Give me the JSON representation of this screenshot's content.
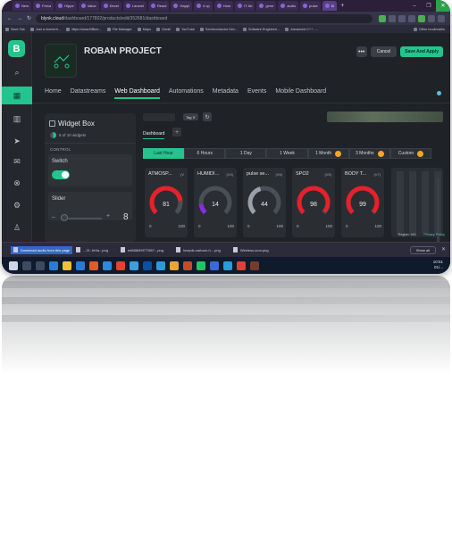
{
  "browser": {
    "tabs": [
      "New",
      "Freca",
      "Hippe",
      "Value",
      "Devel",
      "Laravel",
      "React",
      "Happi",
      "4 up",
      "Hum",
      "IT Ab",
      "gene",
      "audio",
      "pulse",
      "Bl"
    ],
    "url_host": "blynk.cloud",
    "url_path": "/dashboard/177802/products/edit/352681/dashboard",
    "bookmarks": [
      "Save Tab",
      "Just a moment...",
      "https://www.BBlee...",
      "File Manager",
      "Maps",
      "Gmail",
      "YouTube",
      "Semiconductor Dev...",
      "Software Engineeri...",
      "Advanced C++ -..."
    ],
    "bookmarks_right": "Other bookmarks"
  },
  "app": {
    "logo_letter": "B",
    "project_title": "ROBAN PROJECT",
    "buttons": {
      "more": "•••",
      "cancel": "Cancel",
      "save": "Save And Apply"
    },
    "tabs": [
      "Home",
      "Datastreams",
      "Web Dashboard",
      "Automations",
      "Metadata",
      "Events",
      "Mobile Dashboard"
    ],
    "active_tab": "Web Dashboard"
  },
  "widget_box": {
    "title": "Widget Box",
    "count": "5 of 10 widgets",
    "section": "CONTROL",
    "switch_label": "Switch",
    "slider_label": "Slider",
    "slider_minus": "–",
    "slider_plus": "+",
    "slider_value": "8"
  },
  "canvas": {
    "tag_chip": "Tag ✕",
    "refresh": "↻",
    "dashboard_tab": "Dashboard",
    "add_tab": "+",
    "ranges": [
      "Last Hour",
      "6 Hours",
      "1 Day",
      "1 Week",
      "1 Month",
      "3 Months",
      "Custom"
    ],
    "range_badges": [
      false,
      false,
      false,
      false,
      true,
      true,
      true
    ],
    "region": "Region: blr1",
    "privacy": "Privacy Policy"
  },
  "gauges": [
    {
      "title": "ATMOSP...",
      "pin": "(V",
      "value": 81,
      "min": 0,
      "max": 100,
      "color": "#e8202a"
    },
    {
      "title": "HUMIDI...",
      "pin": "(V4)",
      "value": 14,
      "min": 0,
      "max": 100,
      "color": "#8a2be2"
    },
    {
      "title": "pulse se...",
      "pin": "(V6)",
      "value": 44,
      "min": 0,
      "max": 100,
      "color": "#9aa0a7"
    },
    {
      "title": "SPO2",
      "pin": "(V6)",
      "value": 98,
      "min": 0,
      "max": 100,
      "color": "#e8202a"
    },
    {
      "title": "BODY T...",
      "pin": "(V7)",
      "value": 99,
      "min": 0,
      "max": 100,
      "color": "#e8202a"
    }
  ],
  "downloads": {
    "toast": "Download audio from this page",
    "items": [
      "...2f...fe9a...png",
      "ed6880f3f772f67...png",
      "lovepik-cartoon-h....png",
      "Wireless-icon.png"
    ],
    "show_all": "Show all"
  },
  "taskbar": {
    "time": "10:51",
    "date": "01/..."
  },
  "colors": {
    "accent": "#23c48e",
    "bg": "#1f2226",
    "gauge_red": "#e8202a"
  }
}
